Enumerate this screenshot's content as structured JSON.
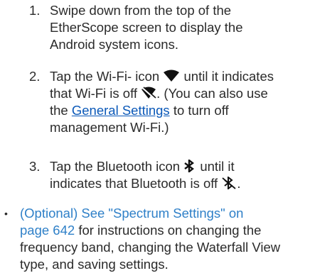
{
  "steps": [
    {
      "number": "1.",
      "lines": [
        "Swipe down from the top of the",
        "EtherScope screen to display the",
        "Android system icons."
      ]
    },
    {
      "number": "2.",
      "line1_pre": "Tap the Wi-Fi- icon",
      "line1_post": "until it indicates",
      "line2_pre": "that Wi-Fi is off",
      "line2_post": ". (You can also use",
      "line3_pre": "the",
      "link_text": "General Settings",
      "line3_post": "to turn off",
      "line4": "management Wi-Fi.)"
    },
    {
      "number": "3.",
      "line1_pre": "Tap the Bluetooth icon",
      "line1_post": "until it",
      "line2_pre": "indicates that Bluetooth is off",
      "line2_post": "."
    }
  ],
  "bullet": {
    "symbol": "•",
    "line1": "(Optional) See \"Spectrum Settings\" on",
    "line2_link": "page 642",
    "line2_post": "for instructions on changing the",
    "line3": "frequency band, changing the Waterfall View",
    "line4": "type, and saving settings."
  },
  "icons": {
    "wifi_on": "wifi-icon",
    "wifi_off": "wifi-off-icon",
    "bluetooth_on": "bluetooth-icon",
    "bluetooth_off": "bluetooth-off-icon"
  },
  "colors": {
    "text": "#2b2b2b",
    "link": "#0a58b8",
    "xref": "#2f80c8",
    "icon": "#111111"
  }
}
